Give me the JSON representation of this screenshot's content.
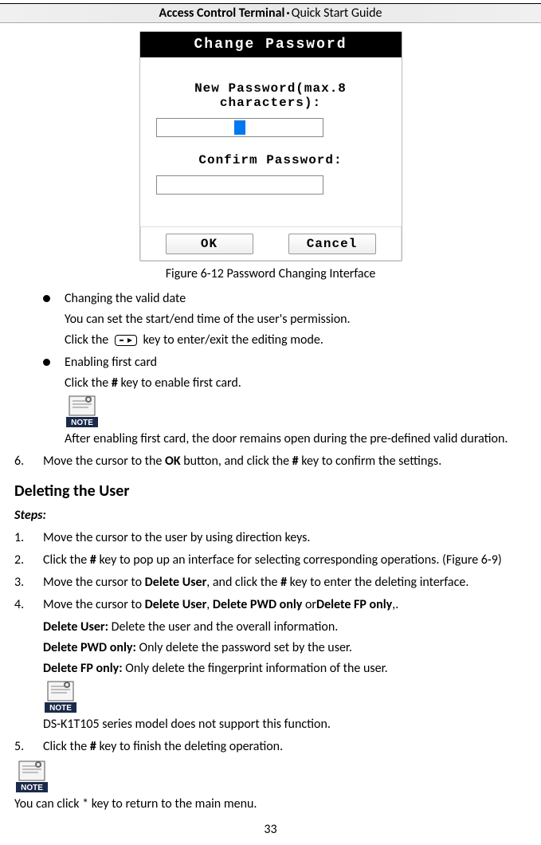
{
  "header": {
    "title_bold": "Access Control Terminal",
    "title_rest": "Quick Start Guide"
  },
  "device": {
    "title": "Change Password",
    "new_pwd_label": "New Password(max.8 characters):",
    "confirm_label": "Confirm Password:",
    "ok": "OK",
    "cancel": "Cancel"
  },
  "figure_caption": "Figure 6-12 Password Changing Interface",
  "bullets": {
    "b1": {
      "title": "Changing the valid date",
      "line1": "You can set the start/end time of the user's permission.",
      "line2a": "Click the",
      "line2b": "key to enter/exit the editing mode."
    },
    "b2": {
      "title": "Enabling first card",
      "line1_a": "Click the ",
      "line1_key": "#",
      "line1_b": " key to enable first card.",
      "note": "After enabling first card, the door remains open during the pre-defined valid duration."
    }
  },
  "step6": {
    "num": "6.",
    "a": "Move the cursor to the ",
    "ok": "OK",
    "b": " button, and click the ",
    "hash": "#",
    "c": " key to confirm the settings."
  },
  "section": {
    "deleting": "Deleting the User",
    "steps": "Steps:"
  },
  "steps": {
    "s1": {
      "num": "1.",
      "text": "Move the cursor to the user by using direction keys."
    },
    "s2": {
      "num": "2.",
      "a": "Click the ",
      "hash": "#",
      "b": " key to pop up an interface for selecting corresponding operations. (Figure 6-9)"
    },
    "s3": {
      "num": "3.",
      "a": "Move the cursor to ",
      "du": "Delete User",
      "b": ", and click the ",
      "hash": "#",
      "c": " key to enter the deleting interface."
    },
    "s4": {
      "num": "4.",
      "a": "Move the cursor to ",
      "du": "Delete User",
      "sep1": ", ",
      "dpo": "Delete PWD only",
      "sep2": " or",
      "dfo": "Delete FP only",
      "end": ",."
    },
    "s4_sub": {
      "du_label": "Delete User:",
      "du_text": " Delete the user and the overall information.",
      "dpo_label": "Delete PWD only:",
      "dpo_text": " Only delete the password set by the user.",
      "dfo_label": "Delete FP only:",
      "dfo_text": " Only delete the fingerprint information of the user.",
      "note": "DS-K1T105 series model does not support this function."
    },
    "s5": {
      "num": "5.",
      "a": "Click the ",
      "hash": "#",
      "b": " key to finish the deleting operation."
    }
  },
  "bottom_note": "You can click * key to return to the main menu.",
  "page_number": "33"
}
